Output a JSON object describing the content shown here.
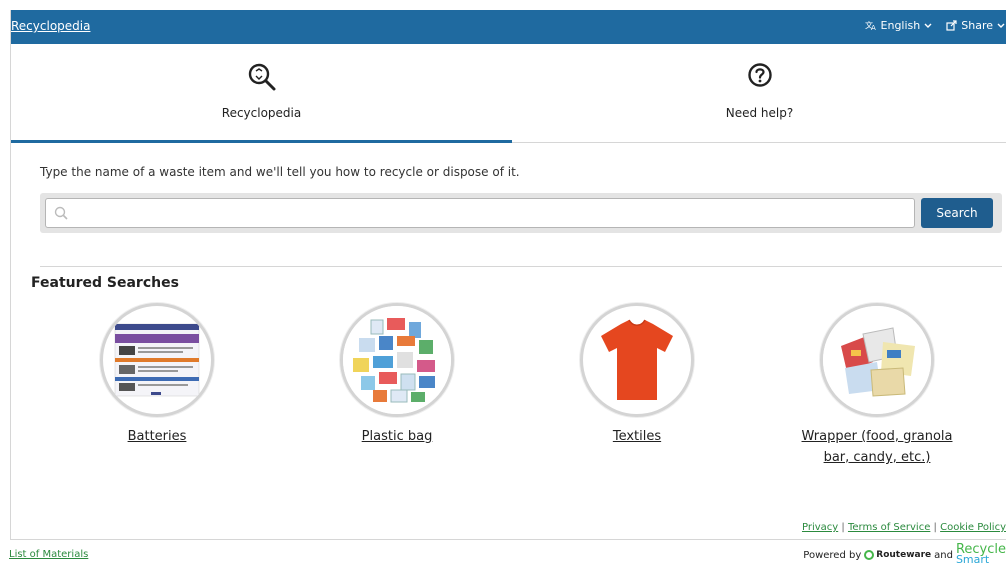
{
  "header": {
    "brand": "Recyclopedia",
    "language_label": "English",
    "share_label": "Share"
  },
  "tabs": [
    {
      "label": "Recyclopedia",
      "icon": "recycle-search-icon",
      "active": true
    },
    {
      "label": "Need help?",
      "icon": "question-circle-icon",
      "active": false
    }
  ],
  "search": {
    "prompt": "Type the name of a waste item and we'll tell you how to recycle or dispose of it.",
    "placeholder": "",
    "button_label": "Search"
  },
  "featured": {
    "title": "Featured Searches",
    "items": [
      {
        "label": "Batteries",
        "image": "battery-disposal-guide-image"
      },
      {
        "label": "Plastic bag",
        "image": "plastic-bags-image"
      },
      {
        "label": "Textiles",
        "image": "red-tshirt-image"
      },
      {
        "label": "Wrapper (food, granola bar, candy, etc.)",
        "image": "food-wrappers-image"
      }
    ]
  },
  "footer": {
    "privacy": "Privacy",
    "terms": "Terms of Service",
    "cookie": "Cookie Policy",
    "materials": "List of Materials",
    "powered_by": "Powered by",
    "routeware": "Routeware",
    "and": "and",
    "recycle_smart_1": "Recycle",
    "recycle_smart_2": "Smart"
  },
  "colors": {
    "primary": "#1f6aa0",
    "button": "#1f5d8e",
    "link_green": "#2b8a3e"
  }
}
